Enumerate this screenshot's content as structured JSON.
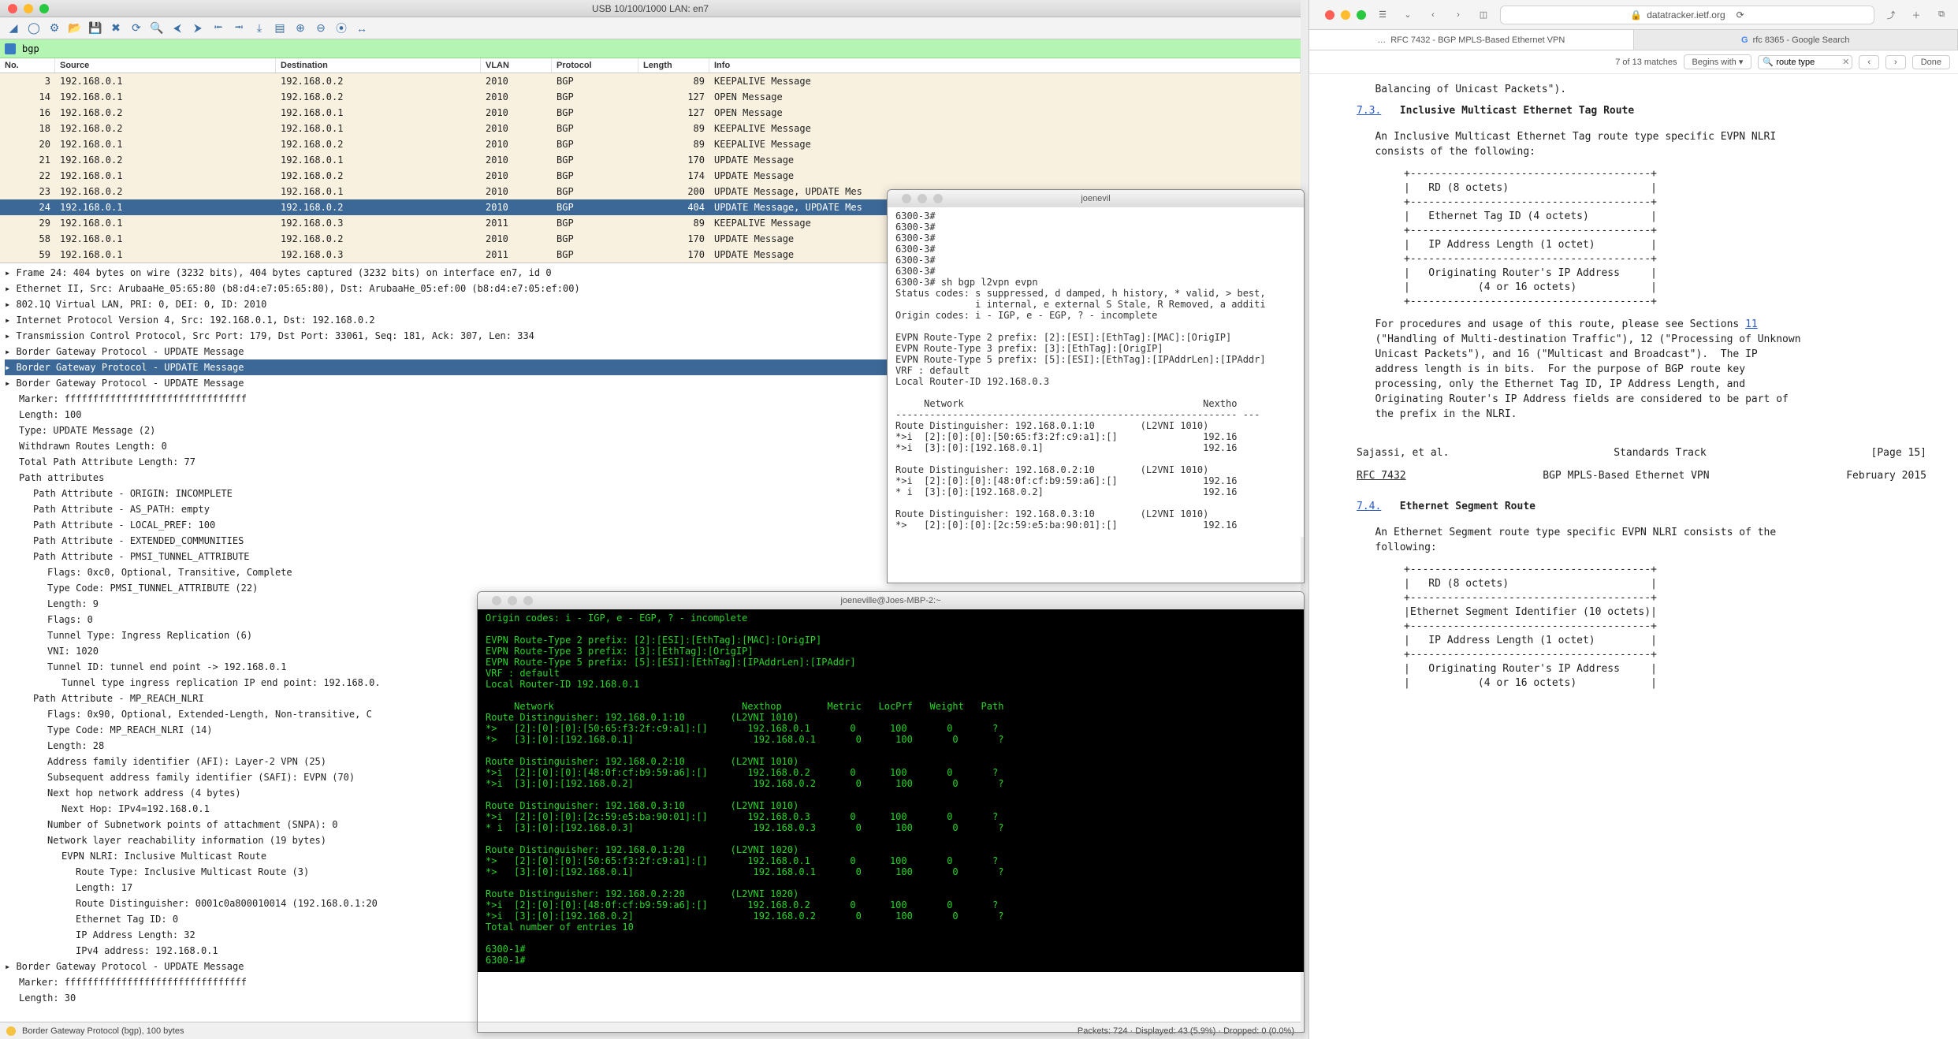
{
  "wireshark": {
    "title": "USB 10/100/1000 LAN: en7",
    "filter": "bgp",
    "columns": [
      "No.",
      "Source",
      "Destination",
      "VLAN",
      "Protocol",
      "Length",
      "Info"
    ],
    "packets": [
      {
        "no": "3",
        "src": "192.168.0.1",
        "dst": "192.168.0.2",
        "vlan": "2010",
        "proto": "BGP",
        "len": "89",
        "info": "KEEPALIVE Message"
      },
      {
        "no": "14",
        "src": "192.168.0.1",
        "dst": "192.168.0.2",
        "vlan": "2010",
        "proto": "BGP",
        "len": "127",
        "info": "OPEN Message"
      },
      {
        "no": "16",
        "src": "192.168.0.2",
        "dst": "192.168.0.1",
        "vlan": "2010",
        "proto": "BGP",
        "len": "127",
        "info": "OPEN Message"
      },
      {
        "no": "18",
        "src": "192.168.0.2",
        "dst": "192.168.0.1",
        "vlan": "2010",
        "proto": "BGP",
        "len": "89",
        "info": "KEEPALIVE Message"
      },
      {
        "no": "20",
        "src": "192.168.0.1",
        "dst": "192.168.0.2",
        "vlan": "2010",
        "proto": "BGP",
        "len": "89",
        "info": "KEEPALIVE Message"
      },
      {
        "no": "21",
        "src": "192.168.0.2",
        "dst": "192.168.0.1",
        "vlan": "2010",
        "proto": "BGP",
        "len": "170",
        "info": "UPDATE Message"
      },
      {
        "no": "22",
        "src": "192.168.0.1",
        "dst": "192.168.0.2",
        "vlan": "2010",
        "proto": "BGP",
        "len": "174",
        "info": "UPDATE Message"
      },
      {
        "no": "23",
        "src": "192.168.0.2",
        "dst": "192.168.0.1",
        "vlan": "2010",
        "proto": "BGP",
        "len": "200",
        "info": "UPDATE Message, UPDATE Mes"
      },
      {
        "no": "24",
        "src": "192.168.0.1",
        "dst": "192.168.0.2",
        "vlan": "2010",
        "proto": "BGP",
        "len": "404",
        "info": "UPDATE Message, UPDATE Mes",
        "hi": true
      },
      {
        "no": "29",
        "src": "192.168.0.1",
        "dst": "192.168.0.3",
        "vlan": "2011",
        "proto": "BGP",
        "len": "89",
        "info": "KEEPALIVE Message"
      },
      {
        "no": "58",
        "src": "192.168.0.1",
        "dst": "192.168.0.2",
        "vlan": "2010",
        "proto": "BGP",
        "len": "170",
        "info": "UPDATE Message"
      },
      {
        "no": "59",
        "src": "192.168.0.1",
        "dst": "192.168.0.3",
        "vlan": "2011",
        "proto": "BGP",
        "len": "170",
        "info": "UPDATE Message"
      }
    ],
    "details": [
      {
        "t": "Frame 24: 404 bytes on wire (3232 bits), 404 bytes captured (3232 bits) on interface en7, id 0",
        "i": 0
      },
      {
        "t": "Ethernet II, Src: ArubaaHe_05:65:80 (b8:d4:e7:05:65:80), Dst: ArubaaHe_05:ef:00 (b8:d4:e7:05:ef:00)",
        "i": 0
      },
      {
        "t": "802.1Q Virtual LAN, PRI: 0, DEI: 0, ID: 2010",
        "i": 0
      },
      {
        "t": "Internet Protocol Version 4, Src: 192.168.0.1, Dst: 192.168.0.2",
        "i": 0
      },
      {
        "t": "Transmission Control Protocol, Src Port: 179, Dst Port: 33061, Seq: 181, Ack: 307, Len: 334",
        "i": 0
      },
      {
        "t": "Border Gateway Protocol - UPDATE Message",
        "i": 0
      },
      {
        "t": "Border Gateway Protocol - UPDATE Message",
        "i": 0,
        "sel": true
      },
      {
        "t": "Border Gateway Protocol - UPDATE Message",
        "i": 0
      },
      {
        "t": "Marker: ffffffffffffffffffffffffffffffff",
        "i": 1
      },
      {
        "t": "Length: 100",
        "i": 1
      },
      {
        "t": "Type: UPDATE Message (2)",
        "i": 1
      },
      {
        "t": "Withdrawn Routes Length: 0",
        "i": 1
      },
      {
        "t": "Total Path Attribute Length: 77",
        "i": 1
      },
      {
        "t": "Path attributes",
        "i": 1
      },
      {
        "t": "Path Attribute - ORIGIN: INCOMPLETE",
        "i": 2
      },
      {
        "t": "Path Attribute - AS_PATH: empty",
        "i": 2
      },
      {
        "t": "Path Attribute - LOCAL_PREF: 100",
        "i": 2
      },
      {
        "t": "Path Attribute - EXTENDED_COMMUNITIES",
        "i": 2
      },
      {
        "t": "Path Attribute - PMSI_TUNNEL_ATTRIBUTE",
        "i": 2
      },
      {
        "t": "Flags: 0xc0, Optional, Transitive, Complete",
        "i": 3
      },
      {
        "t": "Type Code: PMSI_TUNNEL_ATTRIBUTE (22)",
        "i": 3
      },
      {
        "t": "Length: 9",
        "i": 3
      },
      {
        "t": "Flags: 0",
        "i": 3
      },
      {
        "t": "Tunnel Type: Ingress Replication (6)",
        "i": 3
      },
      {
        "t": "VNI: 1020",
        "i": 3
      },
      {
        "t": "Tunnel ID: tunnel end point -> 192.168.0.1",
        "i": 3
      },
      {
        "t": "Tunnel type ingress replication IP end point: 192.168.0.",
        "i": 4
      },
      {
        "t": "Path Attribute - MP_REACH_NLRI",
        "i": 2
      },
      {
        "t": "Flags: 0x90, Optional, Extended-Length, Non-transitive, C",
        "i": 3
      },
      {
        "t": "Type Code: MP_REACH_NLRI (14)",
        "i": 3
      },
      {
        "t": "Length: 28",
        "i": 3
      },
      {
        "t": "Address family identifier (AFI): Layer-2 VPN (25)",
        "i": 3
      },
      {
        "t": "Subsequent address family identifier (SAFI): EVPN (70)",
        "i": 3
      },
      {
        "t": "Next hop network address (4 bytes)",
        "i": 3
      },
      {
        "t": "Next Hop: IPv4=192.168.0.1",
        "i": 4
      },
      {
        "t": "Number of Subnetwork points of attachment (SNPA): 0",
        "i": 3
      },
      {
        "t": "Network layer reachability information (19 bytes)",
        "i": 3
      },
      {
        "t": "EVPN NLRI: Inclusive Multicast Route",
        "i": 4
      },
      {
        "t": "Route Type: Inclusive Multicast Route (3)",
        "i": 5
      },
      {
        "t": "Length: 17",
        "i": 5
      },
      {
        "t": "Route Distinguisher: 0001c0a800010014 (192.168.0.1:20",
        "i": 5
      },
      {
        "t": "Ethernet Tag ID: 0",
        "i": 5
      },
      {
        "t": "IP Address Length: 32",
        "i": 5
      },
      {
        "t": "IPv4 address: 192.168.0.1",
        "i": 5
      },
      {
        "t": "Border Gateway Protocol - UPDATE Message",
        "i": 0
      },
      {
        "t": "Marker: ffffffffffffffffffffffffffffffff",
        "i": 1
      },
      {
        "t": "Length: 30",
        "i": 1
      }
    ],
    "status_left": "Border Gateway Protocol (bgp), 100 bytes",
    "status_right": "Packets: 724 · Displayed: 43 (5.9%) · Dropped: 0 (0.0%)"
  },
  "term_top": {
    "title": "joenevil",
    "body": "6300-3#\n6300-3#\n6300-3#\n6300-3#\n6300-3#\n6300-3#\n6300-3# sh bgp l2vpn evpn\nStatus codes: s suppressed, d damped, h history, * valid, > best,\n              i internal, e external S Stale, R Removed, a additi\nOrigin codes: i - IGP, e - EGP, ? - incomplete\n\nEVPN Route-Type 2 prefix: [2]:[ESI]:[EthTag]:[MAC]:[OrigIP]\nEVPN Route-Type 3 prefix: [3]:[EthTag]:[OrigIP]\nEVPN Route-Type 5 prefix: [5]:[ESI]:[EthTag]:[IPAddrLen]:[IPAddr]\nVRF : default\nLocal Router-ID 192.168.0.3\n\n     Network                                          Nextho\n------------------------------------------------------------ ---\nRoute Distinguisher: 192.168.0.1:10        (L2VNI 1010)\n*>i  [2]:[0]:[0]:[50:65:f3:2f:c9:a1]:[]               192.16\n*>i  [3]:[0]:[192.168.0.1]                            192.16\n\nRoute Distinguisher: 192.168.0.2:10        (L2VNI 1010)\n*>i  [2]:[0]:[0]:[48:0f:cf:b9:59:a6]:[]               192.16\n* i  [3]:[0]:[192.168.0.2]                            192.16\n\nRoute Distinguisher: 192.168.0.3:10        (L2VNI 1010)\n*>   [2]:[0]:[0]:[2c:59:e5:ba:90:01]:[]               192.16"
  },
  "term_bot": {
    "title": "joeneville@Joes-MBP-2:~",
    "lines": [
      "Origin codes: i - IGP, e - EGP, ? - incomplete",
      "",
      "EVPN Route-Type 2 prefix: [2]:[ESI]:[EthTag]:[MAC]:[OrigIP]",
      "EVPN Route-Type 3 prefix: [3]:[EthTag]:[OrigIP]",
      "EVPN Route-Type 5 prefix: [5]:[ESI]:[EthTag]:[IPAddrLen]:[IPAddr]",
      "VRF : default",
      "Local Router-ID 192.168.0.1",
      "",
      "     Network                                 Nexthop        Metric   LocPrf   Weight   Path",
      "Route Distinguisher: 192.168.0.1:10        (L2VNI 1010)",
      "*>   [2]:[0]:[0]:[50:65:f3:2f:c9:a1]:[]       192.168.0.1       0      100       0       ?",
      "*>   [3]:[0]:[192.168.0.1]                     192.168.0.1       0      100       0       ?",
      "",
      "Route Distinguisher: 192.168.0.2:10        (L2VNI 1010)",
      "*>i  [2]:[0]:[0]:[48:0f:cf:b9:59:a6]:[]       192.168.0.2       0      100       0       ?",
      "*>i  [3]:[0]:[192.168.0.2]                     192.168.0.2       0      100       0       ?",
      "",
      "Route Distinguisher: 192.168.0.3:10        (L2VNI 1010)",
      "*>i  [2]:[0]:[0]:[2c:59:e5:ba:90:01]:[]       192.168.0.3       0      100       0       ?",
      "* i  [3]:[0]:[192.168.0.3]                     192.168.0.3       0      100       0       ?",
      "",
      "Route Distinguisher: 192.168.0.1:20        (L2VNI 1020)",
      "*>   [2]:[0]:[0]:[50:65:f3:2f:c9:a1]:[]       192.168.0.1       0      100       0       ?",
      "*>   [3]:[0]:[192.168.0.1]                     192.168.0.1       0      100       0       ?",
      "",
      "Route Distinguisher: 192.168.0.2:20        (L2VNI 1020)",
      "*>i  [2]:[0]:[0]:[48:0f:cf:b9:59:a6]:[]       192.168.0.2       0      100       0       ?",
      "*>i  [3]:[0]:[192.168.0.2]                     192.168.0.2       0      100       0       ?",
      "Total number of entries 10",
      "",
      "6300-1#",
      "6300-1#"
    ]
  },
  "safari": {
    "address": "datatracker.ietf.org",
    "tabs": [
      {
        "label": "RFC 7432 - BGP MPLS-Based Ethernet VPN",
        "active": true,
        "icon": "…"
      },
      {
        "label": "rfc 8365 - Google Search",
        "active": false,
        "icon": "G"
      }
    ],
    "find": {
      "matches": "7 of 13 matches",
      "begins": "Begins with",
      "query": "route type",
      "done": "Done"
    },
    "content": {
      "balancing": "   Balancing of Unicast Packets\").",
      "sec73_num": "7.3.",
      "sec73_title": "Inclusive Multicast Ethernet Tag Route",
      "p73": "   An Inclusive Multicast Ethernet Tag route type specific EVPN NLRI\n   consists of the following:",
      "box73": "+---------------------------------------+\n|   RD (8 octets)                       |\n+---------------------------------------+\n|   Ethernet Tag ID (4 octets)          |\n+---------------------------------------+\n|   IP Address Length (1 octet)         |\n+---------------------------------------+\n|   Originating Router's IP Address     |\n|           (4 or 16 octets)            |\n+---------------------------------------+",
      "p73b_a": "   For procedures and usage of this route, please see Sections ",
      "p73b_link": "11",
      "p73b_b": "\n   (\"Handling of Multi-destination Traffic\"), 12 (\"Processing of Unknown\n   Unicast Packets\"), and 16 (\"Multicast and Broadcast\").  The IP\n   address length is in bits.  For the purpose of BGP route key\n   processing, only the Ethernet Tag ID, IP Address Length, and\n   Originating Router's IP Address fields are considered to be part of\n   the prefix in the NLRI.",
      "foot_l": "Sajassi, et al.",
      "foot_c": "Standards Track",
      "foot_r": "[Page 15]",
      "foot2_l": "RFC 7432",
      "foot2_c": "BGP MPLS-Based Ethernet VPN",
      "foot2_r": "February 2015",
      "sec74_num": "7.4.",
      "sec74_title": "Ethernet Segment Route",
      "p74": "   An Ethernet Segment route type specific EVPN NLRI consists of the\n   following:",
      "box74": "+---------------------------------------+\n|   RD (8 octets)                       |\n+---------------------------------------+\n|Ethernet Segment Identifier (10 octets)|\n+---------------------------------------+\n|   IP Address Length (1 octet)         |\n+---------------------------------------+\n|   Originating Router's IP Address     |\n|           (4 or 16 octets)            |"
    }
  }
}
